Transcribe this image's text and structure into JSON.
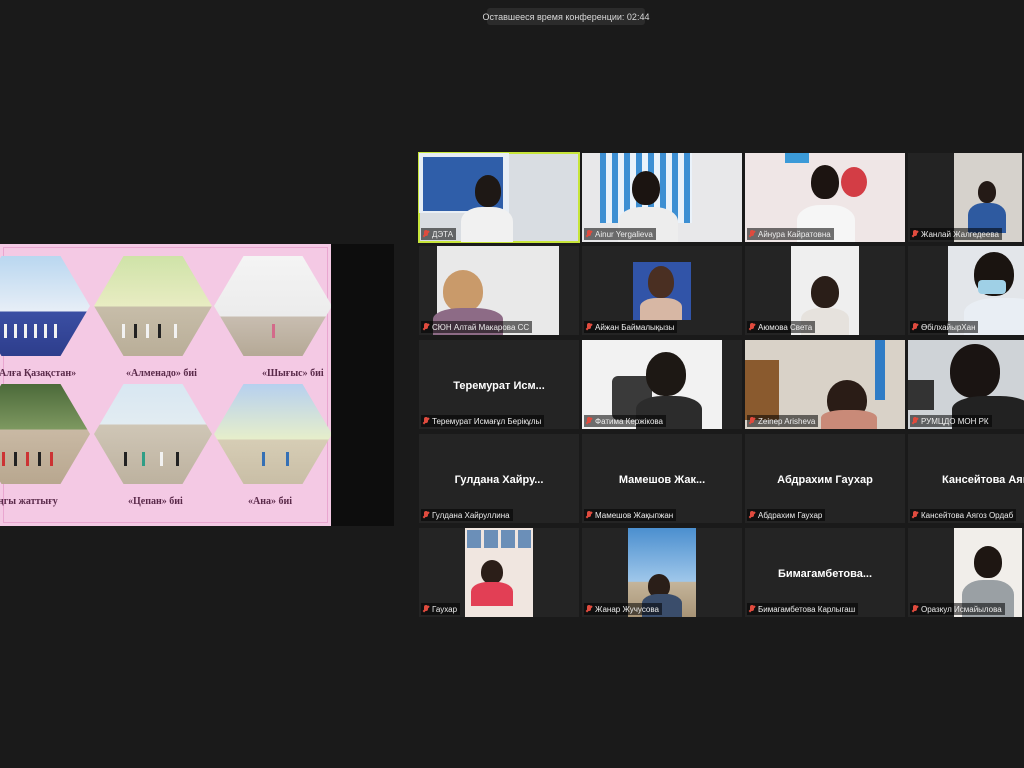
{
  "meeting": {
    "timer": "Оставшееся время конференции: 02:44"
  },
  "shared_screen": {
    "captions": [
      "«Алға Қазақстан»",
      "«Алменадо» биі",
      "«Шығыс» биі",
      "ңгы жаттығу",
      "«Цепан» биі",
      "«Ана» биі"
    ]
  },
  "participants": [
    {
      "name": "ДЭТА",
      "big": "",
      "active": true
    },
    {
      "name": "Ainur Yergalieva",
      "big": ""
    },
    {
      "name": "Айнура Кайратовна",
      "big": ""
    },
    {
      "name": "Жанлай Жалгедеева",
      "big": ""
    },
    {
      "name": "СЮН Алтай Макарова СС",
      "big": ""
    },
    {
      "name": "Айжан Баймалықызы",
      "big": ""
    },
    {
      "name": "Аюмова Света",
      "big": ""
    },
    {
      "name": "ӨбілхайырХан",
      "big": ""
    },
    {
      "name": "Теремурат Исмағұл Берікұлы",
      "big": "Теремурат Исм..."
    },
    {
      "name": "Фатима Кержікова",
      "big": ""
    },
    {
      "name": "Zeinep Arisheva",
      "big": ""
    },
    {
      "name": "РУМЦДО МОН РК",
      "big": ""
    },
    {
      "name": "Гулдана Хайруллина",
      "big": "Гулдана Хайру..."
    },
    {
      "name": "Мамешов Жақыпжан",
      "big": "Мамешов Жак..."
    },
    {
      "name": "Абдрахим Гаухар",
      "big": "Абдрахим Гаухар"
    },
    {
      "name": "Кансейтова Аягоз Ордаб",
      "big": "Кансейтова Аяг"
    },
    {
      "name": "Гаухар",
      "big": ""
    },
    {
      "name": "Жанар Жучусова",
      "big": ""
    },
    {
      "name": "Бимагамбетова Карлыгаш",
      "big": "Бимагамбетова..."
    },
    {
      "name": "Оразкул Исмайылова",
      "big": ""
    }
  ]
}
